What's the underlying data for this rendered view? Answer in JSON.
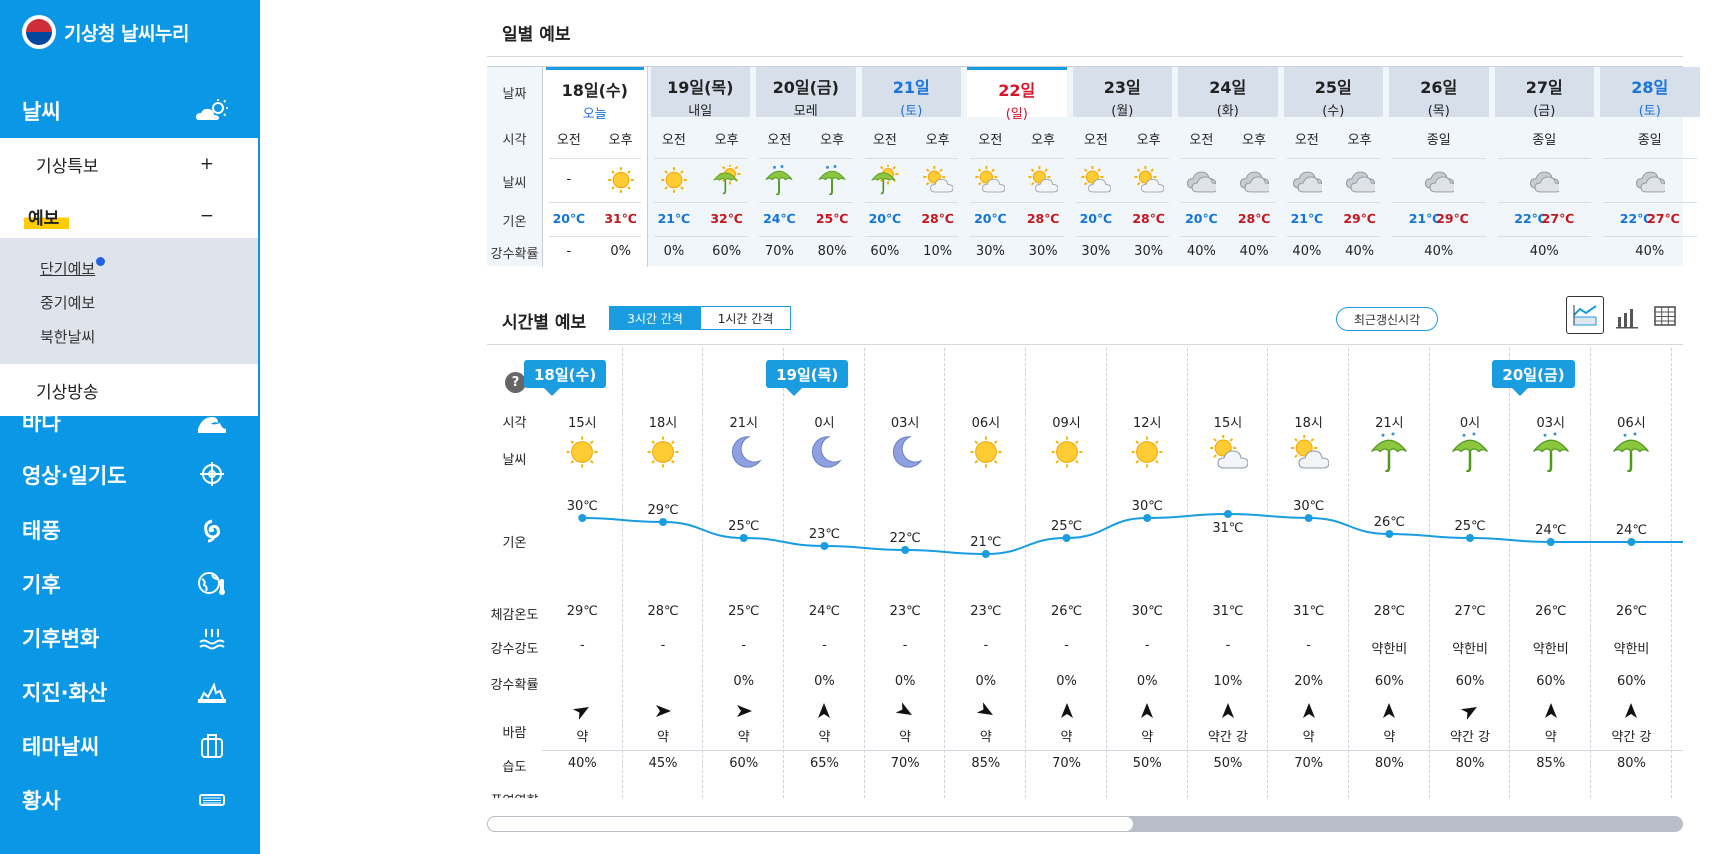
{
  "sidebar": {
    "logo": "기상청 날씨누리",
    "items": [
      {
        "label": "날씨",
        "icon": "weather-icon"
      },
      {
        "label": "바다",
        "icon": "wave-icon"
      },
      {
        "label": "영상·일기도",
        "icon": "satellite-target-icon"
      },
      {
        "label": "태풍",
        "icon": "typhoon-icon"
      },
      {
        "label": "기후",
        "icon": "globe-thermometer-icon"
      },
      {
        "label": "기후변화",
        "icon": "sea-level-icon"
      },
      {
        "label": "지진·화산",
        "icon": "earthquake-icon"
      },
      {
        "label": "테마날씨",
        "icon": "briefcase-icon"
      },
      {
        "label": "황사",
        "icon": "dust-icon"
      }
    ],
    "sub": [
      {
        "label": "기상특보",
        "toggle": "+"
      },
      {
        "label": "예보",
        "toggle": "−"
      },
      {
        "label": "기상방송"
      }
    ],
    "sub2": [
      "단기예보",
      "중기예보",
      "북한날씨"
    ]
  },
  "daily": {
    "title": "일별 예보",
    "row_labels": [
      "날짜",
      "시각",
      "날씨",
      "기온",
      "강수확률"
    ],
    "days": [
      {
        "date": "18일(수)",
        "sub": "오늘",
        "type": "today",
        "times": [
          "오전",
          "오후"
        ],
        "icons": [
          "none",
          "sun"
        ],
        "temps": [
          "20℃",
          "31℃"
        ],
        "pops": [
          "-",
          "0%"
        ]
      },
      {
        "date": "19일(목)",
        "sub": "내일",
        "type": "",
        "times": [
          "오전",
          "오후"
        ],
        "icons": [
          "sun",
          "umbrella-sun"
        ],
        "temps": [
          "21℃",
          "32℃"
        ],
        "pops": [
          "0%",
          "60%"
        ]
      },
      {
        "date": "20일(금)",
        "sub": "모레",
        "type": "",
        "times": [
          "오전",
          "오후"
        ],
        "icons": [
          "umbrella",
          "umbrella"
        ],
        "temps": [
          "24℃",
          "25℃"
        ],
        "pops": [
          "70%",
          "80%"
        ]
      },
      {
        "date": "21일",
        "sub": "(토)",
        "type": "sat",
        "times": [
          "오전",
          "오후"
        ],
        "icons": [
          "umbrella-sun",
          "sun-cloud"
        ],
        "temps": [
          "20℃",
          "28℃"
        ],
        "pops": [
          "60%",
          "10%"
        ]
      },
      {
        "date": "22일",
        "sub": "(일)",
        "type": "sun",
        "times": [
          "오전",
          "오후"
        ],
        "icons": [
          "sun-cloud",
          "sun-cloud"
        ],
        "temps": [
          "20℃",
          "28℃"
        ],
        "pops": [
          "30%",
          "30%"
        ]
      },
      {
        "date": "23일",
        "sub": "(월)",
        "type": "",
        "times": [
          "오전",
          "오후"
        ],
        "icons": [
          "sun-cloud",
          "sun-cloud"
        ],
        "temps": [
          "20℃",
          "28℃"
        ],
        "pops": [
          "30%",
          "30%"
        ]
      },
      {
        "date": "24일",
        "sub": "(화)",
        "type": "",
        "times": [
          "오전",
          "오후"
        ],
        "icons": [
          "cloud",
          "cloud"
        ],
        "temps": [
          "20℃",
          "28℃"
        ],
        "pops": [
          "40%",
          "40%"
        ]
      },
      {
        "date": "25일",
        "sub": "(수)",
        "type": "",
        "times": [
          "오전",
          "오후"
        ],
        "icons": [
          "cloud",
          "cloud"
        ],
        "temps": [
          "21℃",
          "29℃"
        ],
        "pops": [
          "40%",
          "40%"
        ]
      },
      {
        "date": "26일",
        "sub": "(목)",
        "type": "",
        "times": [
          "종일"
        ],
        "icons": [
          "cloud"
        ],
        "temps": [
          "21℃",
          "29℃"
        ],
        "pops": [
          "40%"
        ]
      },
      {
        "date": "27일",
        "sub": "(금)",
        "type": "",
        "times": [
          "종일"
        ],
        "icons": [
          "cloud"
        ],
        "temps": [
          "22℃",
          "27℃"
        ],
        "pops": [
          "40%"
        ]
      },
      {
        "date": "28일",
        "sub": "(토)",
        "type": "sat",
        "times": [
          "종일"
        ],
        "icons": [
          "cloud"
        ],
        "temps": [
          "22℃",
          "27℃"
        ],
        "pops": [
          "40%"
        ]
      }
    ]
  },
  "hourly": {
    "title": "시간별 예보",
    "interval_3h": "3시간 간격",
    "interval_1h": "1시간 간격",
    "recent_button": "최근갱신시각",
    "help": "?",
    "row_labels": [
      "시각",
      "날씨",
      "기온",
      "체감온도",
      "강수강도",
      "강수확률",
      "바람",
      "습도",
      "폭염영향"
    ],
    "day_tags": [
      {
        "label": "18일(수)",
        "col": 0
      },
      {
        "label": "19일(목)",
        "col": 3
      },
      {
        "label": "20일(금)",
        "col": 12
      }
    ],
    "hours": [
      {
        "time": "15시",
        "icon": "sun",
        "temp": 30,
        "feel": "29℃",
        "intensity": "-",
        "pop": "",
        "wind_dir": 60,
        "wind": "약",
        "humidity": "40%"
      },
      {
        "time": "18시",
        "icon": "sun",
        "temp": 29,
        "feel": "28℃",
        "intensity": "-",
        "pop": "",
        "wind_dir": 90,
        "wind": "약",
        "humidity": "45%"
      },
      {
        "time": "21시",
        "icon": "moon",
        "temp": 25,
        "feel": "25℃",
        "intensity": "-",
        "pop": "0%",
        "wind_dir": 90,
        "wind": "약",
        "humidity": "60%"
      },
      {
        "time": "0시",
        "icon": "moon",
        "temp": 23,
        "feel": "24℃",
        "intensity": "-",
        "pop": "0%",
        "wind_dir": 0,
        "wind": "약",
        "humidity": "65%"
      },
      {
        "time": "03시",
        "icon": "moon",
        "temp": 22,
        "feel": "23℃",
        "intensity": "-",
        "pop": "0%",
        "wind_dir": 120,
        "wind": "약",
        "humidity": "70%"
      },
      {
        "time": "06시",
        "icon": "sun",
        "temp": 21,
        "feel": "23℃",
        "intensity": "-",
        "pop": "0%",
        "wind_dir": 120,
        "wind": "약",
        "humidity": "85%"
      },
      {
        "time": "09시",
        "icon": "sun",
        "temp": 25,
        "feel": "26℃",
        "intensity": "-",
        "pop": "0%",
        "wind_dir": 0,
        "wind": "약",
        "humidity": "70%"
      },
      {
        "time": "12시",
        "icon": "sun",
        "temp": 30,
        "feel": "30℃",
        "intensity": "-",
        "pop": "0%",
        "wind_dir": 0,
        "wind": "약",
        "humidity": "50%"
      },
      {
        "time": "15시",
        "icon": "sun-cloud",
        "temp": 31,
        "feel": "31℃",
        "intensity": "-",
        "pop": "10%",
        "wind_dir": 0,
        "wind": "약간 강",
        "humidity": "50%"
      },
      {
        "time": "18시",
        "icon": "sun-cloud",
        "temp": 30,
        "feel": "31℃",
        "intensity": "-",
        "pop": "20%",
        "wind_dir": 0,
        "wind": "약",
        "humidity": "70%"
      },
      {
        "time": "21시",
        "icon": "umbrella",
        "temp": 26,
        "feel": "28℃",
        "intensity": "약한비",
        "pop": "60%",
        "wind_dir": 0,
        "wind": "약",
        "humidity": "80%"
      },
      {
        "time": "0시",
        "icon": "umbrella",
        "temp": 25,
        "feel": "27℃",
        "intensity": "약한비",
        "pop": "60%",
        "wind_dir": 60,
        "wind": "약간 강",
        "humidity": "80%"
      },
      {
        "time": "03시",
        "icon": "umbrella",
        "temp": 24,
        "feel": "26℃",
        "intensity": "약한비",
        "pop": "60%",
        "wind_dir": 0,
        "wind": "약",
        "humidity": "85%"
      },
      {
        "time": "06시",
        "icon": "umbrella",
        "temp": 24,
        "feel": "26℃",
        "intensity": "약한비",
        "pop": "60%",
        "wind_dir": 0,
        "wind": "약간 강",
        "humidity": "80%"
      }
    ]
  },
  "colors": {
    "sidebar": "#0a97e6",
    "accent": "#1a9ce0",
    "line": "#1a9ce0",
    "sat": "#1a73d6",
    "sun": "#d7142a"
  }
}
